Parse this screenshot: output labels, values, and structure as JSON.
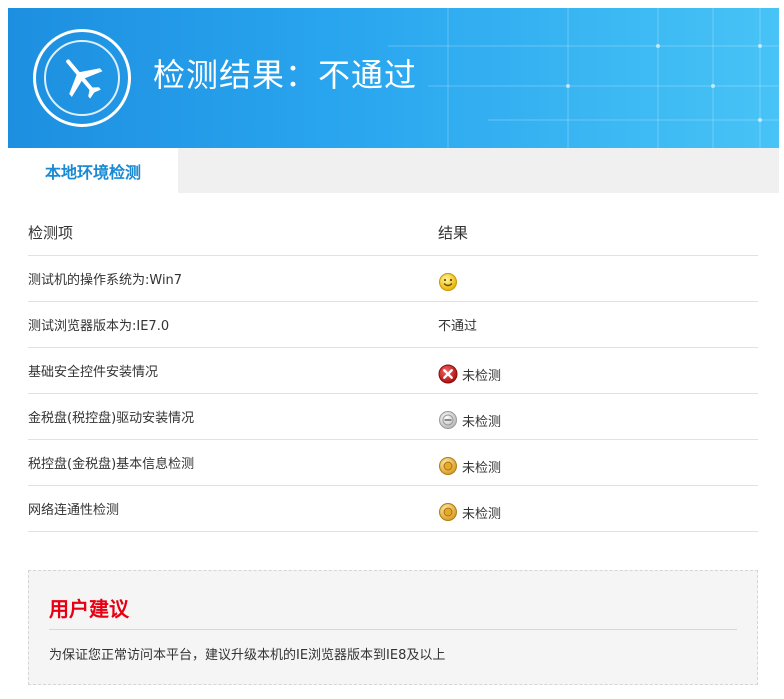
{
  "header": {
    "title": "检测结果：不通过",
    "logo_icon": "airplane-icon",
    "colors": {
      "banner_start": "#1d8fe0",
      "banner_end": "#47c3f6"
    }
  },
  "tabs": [
    {
      "label": "本地环境检测",
      "active": true
    }
  ],
  "table": {
    "columns": [
      "检测项",
      "结果"
    ],
    "rows": [
      {
        "item": "测试机的操作系统为:Win7",
        "result": "",
        "icon": "smiley-icon"
      },
      {
        "item": "测试浏览器版本为:IE7.0",
        "result": "不通过",
        "icon": ""
      },
      {
        "item": "基础安全控件安装情况",
        "result": "未检测",
        "icon": "error-x-icon"
      },
      {
        "item": "金税盘(税控盘)驱动安装情况",
        "result": "未检测",
        "icon": "minus-circle-icon"
      },
      {
        "item": "税控盘(金税盘)基本信息检测",
        "result": "未检测",
        "icon": "pending-circle-icon"
      },
      {
        "item": "网络连通性检测",
        "result": "未检测",
        "icon": "pending-circle-icon"
      }
    ]
  },
  "suggestion": {
    "title": "用户建议",
    "text": "为保证您正常访问本平台，建议升级本机的IE浏览器版本到IE8及以上",
    "title_color": "#e60012"
  },
  "colors": {
    "accent": "#1a8ad4"
  }
}
